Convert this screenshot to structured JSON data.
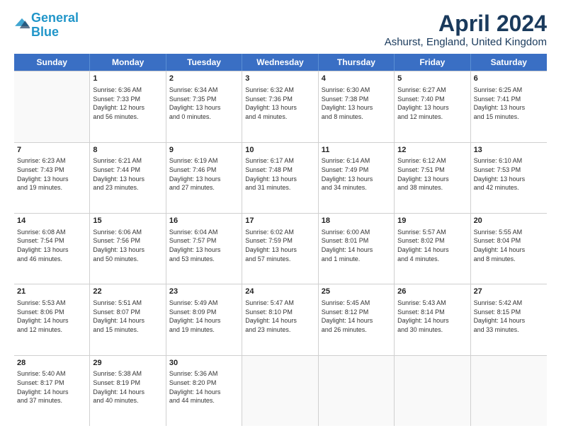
{
  "header": {
    "logo_general": "General",
    "logo_blue": "Blue",
    "month_title": "April 2024",
    "location": "Ashurst, England, United Kingdom"
  },
  "weekdays": [
    "Sunday",
    "Monday",
    "Tuesday",
    "Wednesday",
    "Thursday",
    "Friday",
    "Saturday"
  ],
  "weeks": [
    [
      {
        "day": "",
        "content": ""
      },
      {
        "day": "1",
        "content": "Sunrise: 6:36 AM\nSunset: 7:33 PM\nDaylight: 12 hours\nand 56 minutes."
      },
      {
        "day": "2",
        "content": "Sunrise: 6:34 AM\nSunset: 7:35 PM\nDaylight: 13 hours\nand 0 minutes."
      },
      {
        "day": "3",
        "content": "Sunrise: 6:32 AM\nSunset: 7:36 PM\nDaylight: 13 hours\nand 4 minutes."
      },
      {
        "day": "4",
        "content": "Sunrise: 6:30 AM\nSunset: 7:38 PM\nDaylight: 13 hours\nand 8 minutes."
      },
      {
        "day": "5",
        "content": "Sunrise: 6:27 AM\nSunset: 7:40 PM\nDaylight: 13 hours\nand 12 minutes."
      },
      {
        "day": "6",
        "content": "Sunrise: 6:25 AM\nSunset: 7:41 PM\nDaylight: 13 hours\nand 15 minutes."
      }
    ],
    [
      {
        "day": "7",
        "content": "Sunrise: 6:23 AM\nSunset: 7:43 PM\nDaylight: 13 hours\nand 19 minutes."
      },
      {
        "day": "8",
        "content": "Sunrise: 6:21 AM\nSunset: 7:44 PM\nDaylight: 13 hours\nand 23 minutes."
      },
      {
        "day": "9",
        "content": "Sunrise: 6:19 AM\nSunset: 7:46 PM\nDaylight: 13 hours\nand 27 minutes."
      },
      {
        "day": "10",
        "content": "Sunrise: 6:17 AM\nSunset: 7:48 PM\nDaylight: 13 hours\nand 31 minutes."
      },
      {
        "day": "11",
        "content": "Sunrise: 6:14 AM\nSunset: 7:49 PM\nDaylight: 13 hours\nand 34 minutes."
      },
      {
        "day": "12",
        "content": "Sunrise: 6:12 AM\nSunset: 7:51 PM\nDaylight: 13 hours\nand 38 minutes."
      },
      {
        "day": "13",
        "content": "Sunrise: 6:10 AM\nSunset: 7:53 PM\nDaylight: 13 hours\nand 42 minutes."
      }
    ],
    [
      {
        "day": "14",
        "content": "Sunrise: 6:08 AM\nSunset: 7:54 PM\nDaylight: 13 hours\nand 46 minutes."
      },
      {
        "day": "15",
        "content": "Sunrise: 6:06 AM\nSunset: 7:56 PM\nDaylight: 13 hours\nand 50 minutes."
      },
      {
        "day": "16",
        "content": "Sunrise: 6:04 AM\nSunset: 7:57 PM\nDaylight: 13 hours\nand 53 minutes."
      },
      {
        "day": "17",
        "content": "Sunrise: 6:02 AM\nSunset: 7:59 PM\nDaylight: 13 hours\nand 57 minutes."
      },
      {
        "day": "18",
        "content": "Sunrise: 6:00 AM\nSunset: 8:01 PM\nDaylight: 14 hours\nand 1 minute."
      },
      {
        "day": "19",
        "content": "Sunrise: 5:57 AM\nSunset: 8:02 PM\nDaylight: 14 hours\nand 4 minutes."
      },
      {
        "day": "20",
        "content": "Sunrise: 5:55 AM\nSunset: 8:04 PM\nDaylight: 14 hours\nand 8 minutes."
      }
    ],
    [
      {
        "day": "21",
        "content": "Sunrise: 5:53 AM\nSunset: 8:06 PM\nDaylight: 14 hours\nand 12 minutes."
      },
      {
        "day": "22",
        "content": "Sunrise: 5:51 AM\nSunset: 8:07 PM\nDaylight: 14 hours\nand 15 minutes."
      },
      {
        "day": "23",
        "content": "Sunrise: 5:49 AM\nSunset: 8:09 PM\nDaylight: 14 hours\nand 19 minutes."
      },
      {
        "day": "24",
        "content": "Sunrise: 5:47 AM\nSunset: 8:10 PM\nDaylight: 14 hours\nand 23 minutes."
      },
      {
        "day": "25",
        "content": "Sunrise: 5:45 AM\nSunset: 8:12 PM\nDaylight: 14 hours\nand 26 minutes."
      },
      {
        "day": "26",
        "content": "Sunrise: 5:43 AM\nSunset: 8:14 PM\nDaylight: 14 hours\nand 30 minutes."
      },
      {
        "day": "27",
        "content": "Sunrise: 5:42 AM\nSunset: 8:15 PM\nDaylight: 14 hours\nand 33 minutes."
      }
    ],
    [
      {
        "day": "28",
        "content": "Sunrise: 5:40 AM\nSunset: 8:17 PM\nDaylight: 14 hours\nand 37 minutes."
      },
      {
        "day": "29",
        "content": "Sunrise: 5:38 AM\nSunset: 8:19 PM\nDaylight: 14 hours\nand 40 minutes."
      },
      {
        "day": "30",
        "content": "Sunrise: 5:36 AM\nSunset: 8:20 PM\nDaylight: 14 hours\nand 44 minutes."
      },
      {
        "day": "",
        "content": ""
      },
      {
        "day": "",
        "content": ""
      },
      {
        "day": "",
        "content": ""
      },
      {
        "day": "",
        "content": ""
      }
    ]
  ]
}
